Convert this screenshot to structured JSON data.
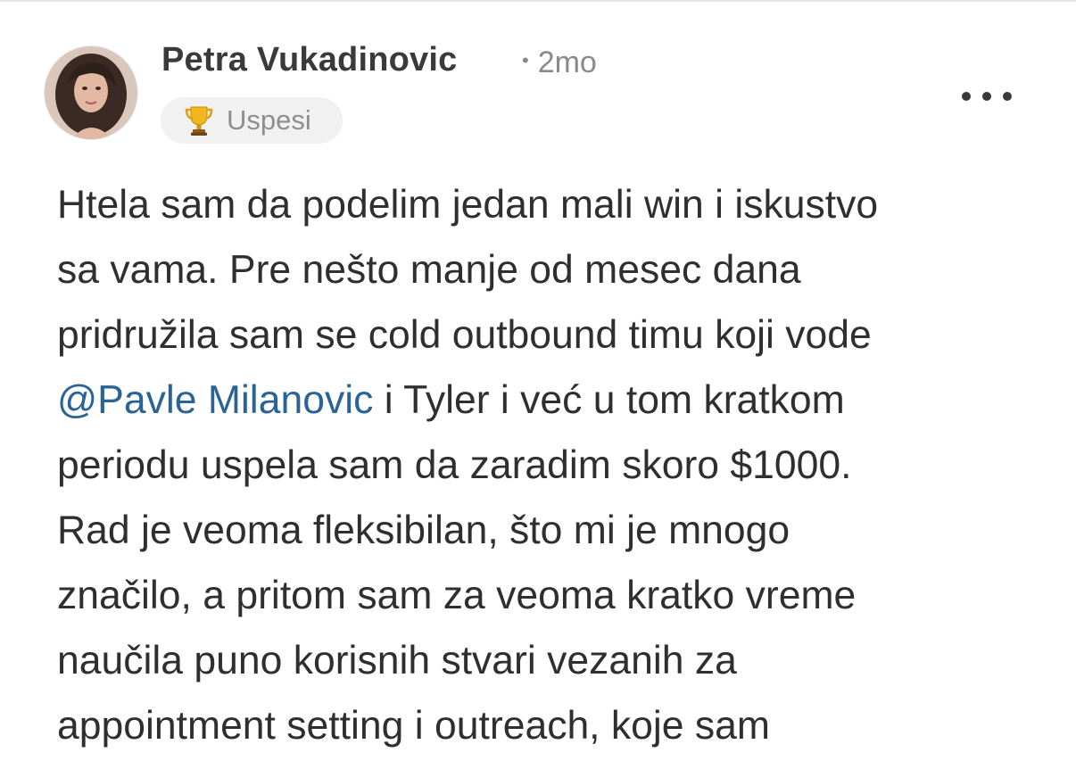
{
  "post": {
    "author": {
      "name": "Petra Vukadinovic",
      "timestamp": "2mo",
      "avatar": "profile-photo"
    },
    "category": {
      "icon": "trophy-icon",
      "label": "Uspesi"
    },
    "menu_icon": "more-horizontal-icon",
    "body": {
      "line1": "Htela sam da podelim jedan mali win i iskustvo",
      "line2": "sa vama. Pre nešto manje od mesec dana",
      "line3": "pridružila sam se cold outbound timu koji vode",
      "mention": "@Pavle Milanovic",
      "line4_rest": " i Tyler i već u tom kratkom",
      "line5": "periodu uspela sam da zaradim skoro $1000.",
      "line6": "Rad je veoma fleksibilan, što mi je mnogo",
      "line7": "značilo, a pritom sam za veoma kratko vreme",
      "line8": "naučila puno korisnih stvari vezanih za",
      "line9": "appointment setting i outreach, koje sam"
    }
  },
  "colors": {
    "text": "#2f2f2f",
    "muted": "#8a8a8a",
    "mention": "#2a6496",
    "badge_bg": "#f1f1f1"
  }
}
